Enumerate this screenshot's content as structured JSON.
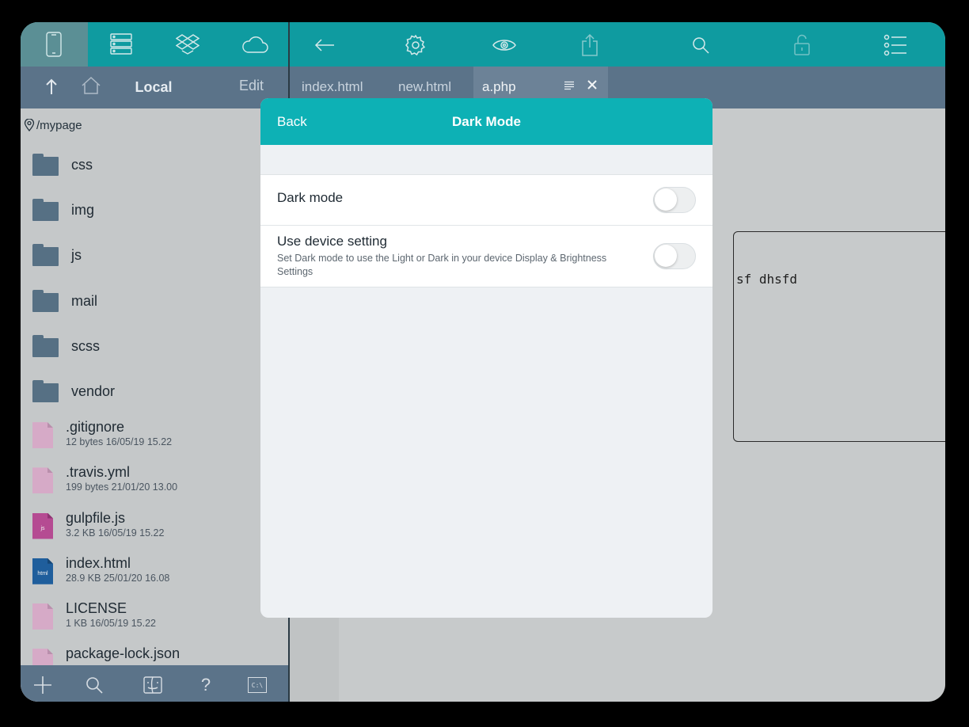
{
  "left_toolbar": {
    "items": [
      {
        "name": "device-icon",
        "active": true
      },
      {
        "name": "server-icon",
        "active": false
      },
      {
        "name": "dropbox-icon",
        "active": false
      },
      {
        "name": "cloud-icon",
        "active": false
      }
    ]
  },
  "left_nav": {
    "title": "Local",
    "edit_label": "Edit"
  },
  "path": "/mypage",
  "folders": [
    {
      "name": "css"
    },
    {
      "name": "img"
    },
    {
      "name": "js"
    },
    {
      "name": "mail"
    },
    {
      "name": "scss"
    },
    {
      "name": "vendor"
    }
  ],
  "files": [
    {
      "name": ".gitignore",
      "meta": "12 bytes 16/05/19 15.22",
      "type": "generic",
      "tag": ""
    },
    {
      "name": ".travis.yml",
      "meta": "199 bytes 21/01/20 13.00",
      "type": "generic",
      "tag": ""
    },
    {
      "name": "gulpfile.js",
      "meta": "3.2 KB 16/05/19 15.22",
      "type": "js",
      "tag": "js"
    },
    {
      "name": "index.html",
      "meta": "28.9 KB 25/01/20 16.08",
      "type": "html",
      "tag": "html"
    },
    {
      "name": "LICENSE",
      "meta": "1 KB 16/05/19 15.22",
      "type": "generic",
      "tag": ""
    },
    {
      "name": "package-lock.json",
      "meta": "",
      "type": "generic",
      "tag": ""
    }
  ],
  "left_bottom": {
    "items": [
      "add-icon",
      "search-icon",
      "finder-icon",
      "help-icon",
      "terminal-icon"
    ],
    "help_label": "?",
    "terminal_label": "C:\\"
  },
  "right_toolbar": {
    "items": [
      "back-arrow-icon",
      "settings-icon",
      "preview-eye-icon",
      "share-icon",
      "search-icon",
      "lock-icon",
      "list-icon"
    ]
  },
  "tabs": [
    {
      "label": "index.html",
      "active": false
    },
    {
      "label": "new.html",
      "active": false
    },
    {
      "label": "a.php",
      "active": true
    }
  ],
  "editor": {
    "visible_code": "sf dhsfd"
  },
  "modal": {
    "back_label": "Back",
    "title": "Dark Mode",
    "settings": [
      {
        "label": "Dark mode",
        "description": "",
        "enabled": false
      },
      {
        "label": "Use device setting",
        "description": "Set Dark mode to use the Light or Dark in your device Display & Brightness Settings",
        "enabled": false
      }
    ]
  },
  "colors": {
    "toolbar_teal": "#0f9ba0",
    "modal_header_teal": "#0db1b5",
    "nav_slate": "#5b7389",
    "folder_blue": "#567084",
    "generic_file_pink": "#d6aac7",
    "js_file_magenta": "#b54b92",
    "html_file_blue": "#1f5e9c"
  }
}
